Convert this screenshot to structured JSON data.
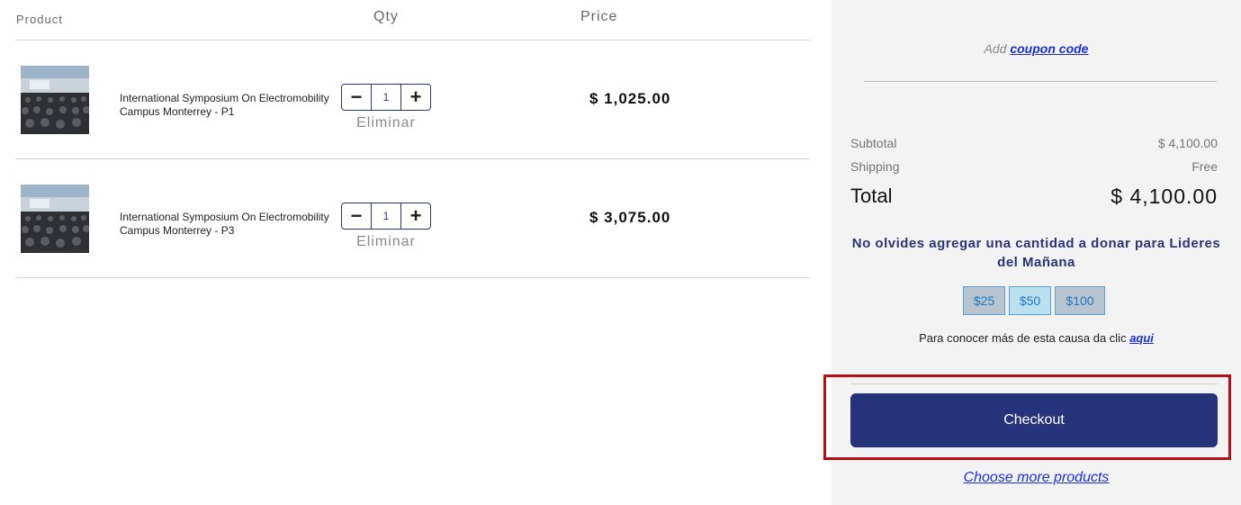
{
  "cart": {
    "headers": {
      "product": "Product",
      "qty": "Qty",
      "price": "Price"
    },
    "items": [
      {
        "name": "International Symposium On Electromobility Campus Monterrey - P1",
        "qty": "1",
        "remove_label": "Eliminar",
        "price": "$ 1,025.00",
        "thumbnail_icon": "event-photo"
      },
      {
        "name": "International Symposium On Electromobility Campus Monterrey - P3",
        "qty": "1",
        "remove_label": "Eliminar",
        "price": "$ 3,075.00",
        "thumbnail_icon": "event-photo"
      }
    ],
    "stepper": {
      "minus": "−",
      "plus": "+"
    }
  },
  "summary": {
    "coupon_prefix": "Add ",
    "coupon_link": "coupon code",
    "subtotal_label": "Subtotal",
    "subtotal_value": "$ 4,100.00",
    "shipping_label": "Shipping",
    "shipping_value": "Free",
    "total_label": "Total",
    "total_value": "$ 4,100.00",
    "donate_message": "No olvides agregar una cantidad a donar para Lideres del Mañana",
    "donate_options": [
      "$25",
      "$50",
      "$100"
    ],
    "cause_prefix": "Para conocer más de esta causa da clic ",
    "cause_link": "aqui",
    "checkout_label": "Checkout",
    "more_products": "Choose more products"
  },
  "colors": {
    "brand": "#26337a",
    "link": "#1a2fd6",
    "highlight": "#b30f16",
    "panel_bg": "#f3f3f3"
  }
}
